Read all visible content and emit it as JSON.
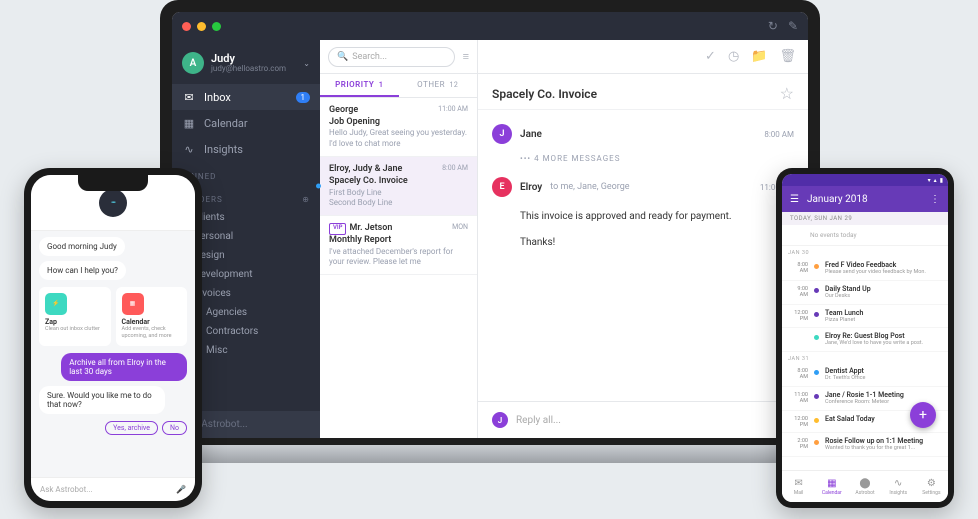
{
  "laptop": {
    "profile": {
      "initial": "A",
      "name": "Judy",
      "email": "judy@helloastro.com"
    },
    "nav": {
      "inbox": "Inbox",
      "inbox_badge": "1",
      "calendar": "Calendar",
      "insights": "Insights"
    },
    "sections": {
      "pinned": "PINNED",
      "folders": "FOLDERS"
    },
    "folders": [
      "Clients",
      "Personal",
      "Design",
      "Development",
      "Invoices"
    ],
    "subfolders": [
      "Agencies",
      "Contractors",
      "Misc"
    ],
    "askbot": "Ask Astrobot...",
    "search_placeholder": "Search...",
    "tabs": {
      "priority": "PRIORITY",
      "priority_count": "1",
      "other": "OTHER",
      "other_count": "12"
    },
    "messages": [
      {
        "from": "George",
        "time": "11:00 AM",
        "subj": "Job Opening",
        "preview": "Hello Judy, Great seeing you yesterday. I'd love to chat more"
      },
      {
        "from": "Elroy, Judy & Jane",
        "time": "8:00 AM",
        "subj": "Spacely Co. Invoice",
        "preview": "First Body Line\nSecond Body Line",
        "selected": true
      },
      {
        "from": "Mr. Jetson",
        "time": "MON",
        "subj": "Monthly Report",
        "preview": "I've attached December's report for your review. Please let me",
        "vip": true
      }
    ],
    "detail": {
      "subject": "Spacely Co. Invoice",
      "row1_name": "Jane",
      "row1_time": "8:00 AM",
      "more": "4 MORE MESSAGES",
      "row2_name": "Elroy",
      "row2_to": "to me, Jane, George",
      "row2_time": "11:00 AM",
      "body1": "This invoice is approved and ready for payment.",
      "body2": "Thanks!",
      "reply_placeholder": "Reply all..."
    }
  },
  "phoneL": {
    "greet": "Good morning Judy",
    "help": "How can I help you?",
    "cards": {
      "zap_title": "Zap",
      "zap_desc": "Clean out inbox clutter",
      "cal_title": "Calendar",
      "cal_desc": "Add events, check upcoming, and more"
    },
    "user1": "Archive all from Elroy in the last 30 days",
    "bot2": "Sure. Would you like me to do that now?",
    "pill_yes": "Yes, archive",
    "pill_no": "No",
    "input_placeholder": "Ask Astrobot..."
  },
  "phoneR": {
    "header": "January 2018",
    "today_hdr": "TODAY, SUN JAN 29",
    "no_events": "No events today",
    "days": {
      "d30": "Jan 30",
      "e1_time": "8:00 AM",
      "e1_title": "Fred F Video Feedback",
      "e1_sub": "Please send your video feedback by Mon.",
      "e2_time": "9:00 AM",
      "e2_title": "Daily Stand Up",
      "e2_sub": "Our Desks",
      "e3_time": "12:00 PM",
      "e3_title": "Team Lunch",
      "e3_sub": "Pizza Planet",
      "e4_time": "",
      "e4_title": "Elroy Re: Guest Blog Post",
      "e4_sub": "Jane, We'd love to have you write a post.",
      "d31": "Jan 31",
      "e5_time": "8:00 AM",
      "e5_title": "Dentist Appt",
      "e5_sub": "Dr. Teeth's Office",
      "e6_time": "11:00 AM",
      "e6_title": "Jane / Rosie 1-1 Meeting",
      "e6_sub": "Conference Room: Meteor",
      "e7_time": "12:00 PM",
      "e7_title": "Eat Salad Today",
      "e7_sub": "",
      "e8_time": "2:00 PM",
      "e8_title": "Rosie Follow up on 1:1 Meeting",
      "e8_sub": "Wanted to thank you for the great 1..."
    },
    "nav": {
      "mail": "Mail",
      "calendar": "Calendar",
      "astrobot": "Astrobot",
      "insights": "Insights",
      "settings": "Settings"
    }
  }
}
